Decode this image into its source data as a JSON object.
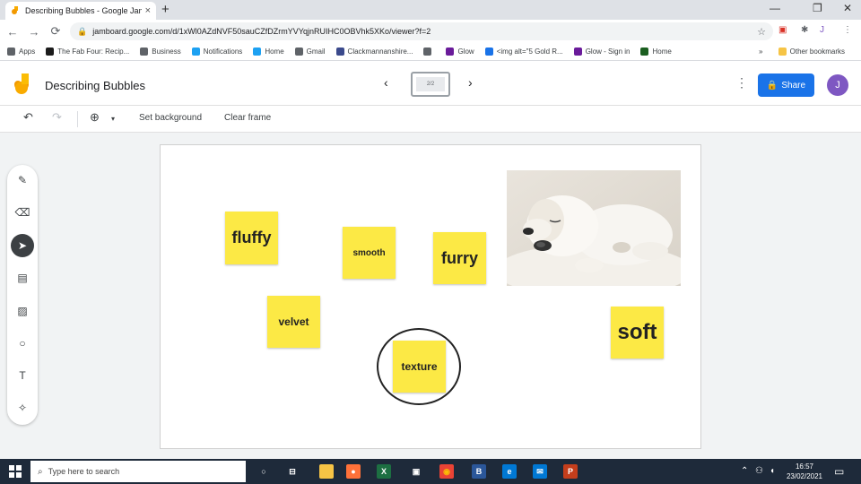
{
  "browser": {
    "tab_title": "Describing Bubbles - Google Jam",
    "tab_close": "×",
    "new_tab": "+",
    "window_controls": [
      "—",
      "❐",
      "✕"
    ],
    "url": "jamboard.google.com/d/1xWl0AZdNVF50sauCZfDZrmYVYqjnRUIHC0OBVhk5XKo/viewer?f=2",
    "ext_icons": [
      {
        "name": "shield-ext-icon",
        "glyph": "▣",
        "color": "#d93025"
      },
      {
        "name": "puzzle-ext-icon",
        "glyph": "✱",
        "color": "#5f6368"
      },
      {
        "name": "profile-avatar-icon",
        "glyph": "J",
        "color": "#7e57c2"
      },
      {
        "name": "menu-kebab-icon",
        "glyph": "⋮",
        "color": "#5f6368"
      }
    ]
  },
  "bookmarks": {
    "items": [
      {
        "label": "Apps",
        "color": "#5f6368"
      },
      {
        "label": "The Fab Four: Recip...",
        "color": "#1c1c1c"
      },
      {
        "label": "Business",
        "color": "#5f6368"
      },
      {
        "label": "Notifications",
        "color": "#1da1f2"
      },
      {
        "label": "Home",
        "color": "#1da1f2"
      },
      {
        "label": "Gmail",
        "color": "#5f6368"
      },
      {
        "label": "Clackmannanshire...",
        "color": "#3b4a8c"
      },
      {
        "label": "",
        "color": "#5f6368"
      },
      {
        "label": "Glow",
        "color": "#6a1b9a"
      },
      {
        "label": "<img alt=\"5 Gold R...",
        "color": "#1a73e8"
      },
      {
        "label": "Glow - Sign in",
        "color": "#6a1b9a"
      },
      {
        "label": "Home",
        "color": "#1b5e20"
      }
    ],
    "overflow": "»",
    "other": "Other bookmarks"
  },
  "jamboard": {
    "title": "Describing Bubbles",
    "prev": "‹",
    "next": "›",
    "frame_label": "2/2",
    "kebab": "⋮",
    "share_label": "Share",
    "avatar_letter": "J"
  },
  "toolbar": {
    "undo": "↶",
    "redo": "↷",
    "zoom": "⊕",
    "zoom_caret": "▾",
    "set_background": "Set background",
    "clear_frame": "Clear frame"
  },
  "tools": [
    {
      "name": "pen-tool-icon",
      "glyph": "✎",
      "active": false
    },
    {
      "name": "eraser-tool-icon",
      "glyph": "⌫",
      "active": false
    },
    {
      "name": "select-tool-icon",
      "glyph": "➤",
      "active": true
    },
    {
      "name": "sticky-note-tool-icon",
      "glyph": "▤",
      "active": false
    },
    {
      "name": "image-tool-icon",
      "glyph": "▨",
      "active": false
    },
    {
      "name": "circle-tool-icon",
      "glyph": "○",
      "active": false
    },
    {
      "name": "text-box-tool-icon",
      "glyph": "T",
      "active": false
    },
    {
      "name": "laser-tool-icon",
      "glyph": "✧",
      "active": false
    }
  ],
  "notes": [
    {
      "id": "fluffy",
      "text": "fluffy"
    },
    {
      "id": "smooth",
      "text": "smooth"
    },
    {
      "id": "furry",
      "text": "furry"
    },
    {
      "id": "velvet",
      "text": "velvet"
    },
    {
      "id": "texture",
      "text": "texture"
    },
    {
      "id": "soft",
      "text": "soft"
    }
  ],
  "taskbar": {
    "search_placeholder": "Type here to search",
    "apps": [
      {
        "name": "task-view-icon",
        "glyph": "○",
        "color": "transparent",
        "fg": "#ffffff"
      },
      {
        "name": "widgets-icon",
        "glyph": "⊟",
        "color": "transparent",
        "fg": "#ffffff"
      },
      {
        "name": "file-explorer-icon",
        "glyph": "▬",
        "color": "#f6c445",
        "fg": "#f6c445"
      },
      {
        "name": "firefox-icon",
        "glyph": "●",
        "color": "#ff7139",
        "fg": "#ffffff"
      },
      {
        "name": "excel-icon",
        "glyph": "X",
        "color": "#1d6f42",
        "fg": "#ffffff"
      },
      {
        "name": "store-icon",
        "glyph": "▣",
        "color": "transparent",
        "fg": "#ffffff"
      },
      {
        "name": "chrome-icon",
        "glyph": "◉",
        "color": "#ea4335",
        "fg": "#fbbc05"
      },
      {
        "name": "b-app-icon",
        "glyph": "B",
        "color": "#2b579a",
        "fg": "#ffffff"
      },
      {
        "name": "edge-icon",
        "glyph": "e",
        "color": "#0078d4",
        "fg": "#ffffff"
      },
      {
        "name": "mail-icon",
        "glyph": "✉",
        "color": "#0078d4",
        "fg": "#ffffff"
      },
      {
        "name": "powerpoint-icon",
        "glyph": "P",
        "color": "#c43e1c",
        "fg": "#ffffff"
      }
    ],
    "tray": [
      "⌃",
      "⚇",
      "◖",
      "🔊"
    ],
    "time": "16:57",
    "date": "23/02/2021",
    "notifications": "▭"
  }
}
